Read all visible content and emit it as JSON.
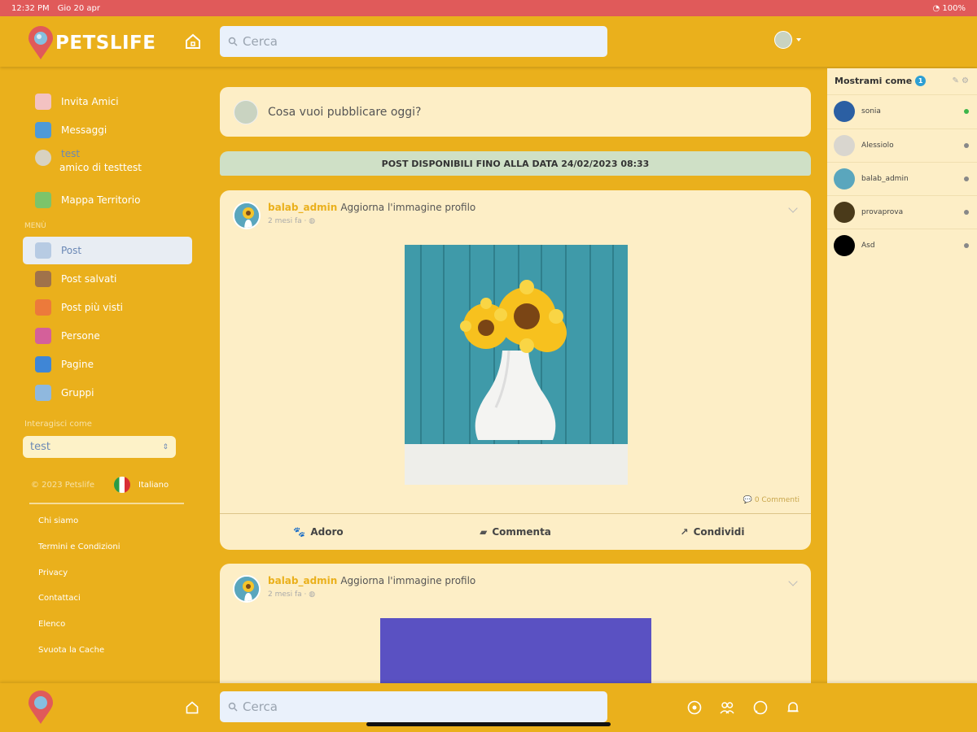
{
  "status_bar": {
    "time": "12:32 PM",
    "date": "Gio 20 apr",
    "battery": "100%"
  },
  "app": {
    "name": "PETSLIFE",
    "brand_color": "#eab01c"
  },
  "search": {
    "placeholder": "Cerca"
  },
  "sidebar": {
    "items": [
      {
        "label": "Invita Amici",
        "icon": "invite-friends-icon"
      },
      {
        "label": "Messaggi",
        "icon": "messages-icon"
      },
      {
        "label": "test",
        "sublabel": "amico di testtest",
        "icon": "user-avatar-icon"
      },
      {
        "label": "Mappa Territorio",
        "icon": "map-icon"
      }
    ],
    "section_label": "MENÙ",
    "menu": [
      {
        "label": "Post",
        "icon": "posts-icon",
        "active": true
      },
      {
        "label": "Post salvati",
        "icon": "saved-posts-icon"
      },
      {
        "label": "Post più visti",
        "icon": "most-viewed-icon"
      },
      {
        "label": "Persone",
        "icon": "people-icon"
      },
      {
        "label": "Pagine",
        "icon": "pages-icon"
      },
      {
        "label": "Gruppi",
        "icon": "groups-icon"
      }
    ],
    "interact_label": "Interagisci come",
    "interact_value": "test",
    "copyright": "© 2023 Petslife",
    "language": "Italiano",
    "footer_links": [
      "Chi siamo",
      "Termini e Condizioni",
      "Privacy",
      "Contattaci",
      "Elenco",
      "Svuota la Cache"
    ]
  },
  "composer": {
    "placeholder": "Cosa vuoi pubblicare oggi?"
  },
  "notice": "POST DISPONIBILI FINO ALLA DATA 24/02/2023 08:33",
  "posts": [
    {
      "author": "balab_admin",
      "action": "Aggiorna l'immagine profilo",
      "time": "2 mesi fa",
      "comments": "0 Commenti"
    },
    {
      "author": "balab_admin",
      "action": "Aggiorna l'immagine profilo",
      "time": "2 mesi fa"
    }
  ],
  "actions": {
    "love": "Adoro",
    "comment": "Commenta",
    "share": "Condividi"
  },
  "right_panel": {
    "title": "Mostrami come",
    "badge": "1",
    "users": [
      {
        "name": "sonia",
        "online": true
      },
      {
        "name": "Alessiolo",
        "online": false
      },
      {
        "name": "balab_admin",
        "online": false
      },
      {
        "name": "provaprova",
        "online": false
      },
      {
        "name": "Asd",
        "online": false
      }
    ]
  }
}
